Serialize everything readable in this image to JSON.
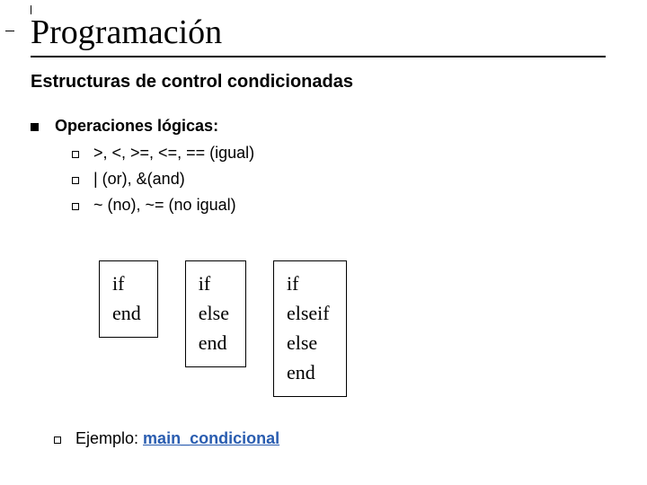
{
  "title": "Programación",
  "subtitle": "Estructuras de control condicionadas",
  "section_heading": "Operaciones lógicas:",
  "bullets": [
    ">, <, >=, <=, == (igual)",
    "| (or),  &(and)",
    "~ (no),  ~= (no igual)"
  ],
  "code_blocks": [
    [
      "if",
      "end"
    ],
    [
      "if",
      "else",
      "end"
    ],
    [
      "if",
      "elseif",
      "else",
      "end"
    ]
  ],
  "example": {
    "label": "Ejemplo: ",
    "link": "main_condicional"
  }
}
